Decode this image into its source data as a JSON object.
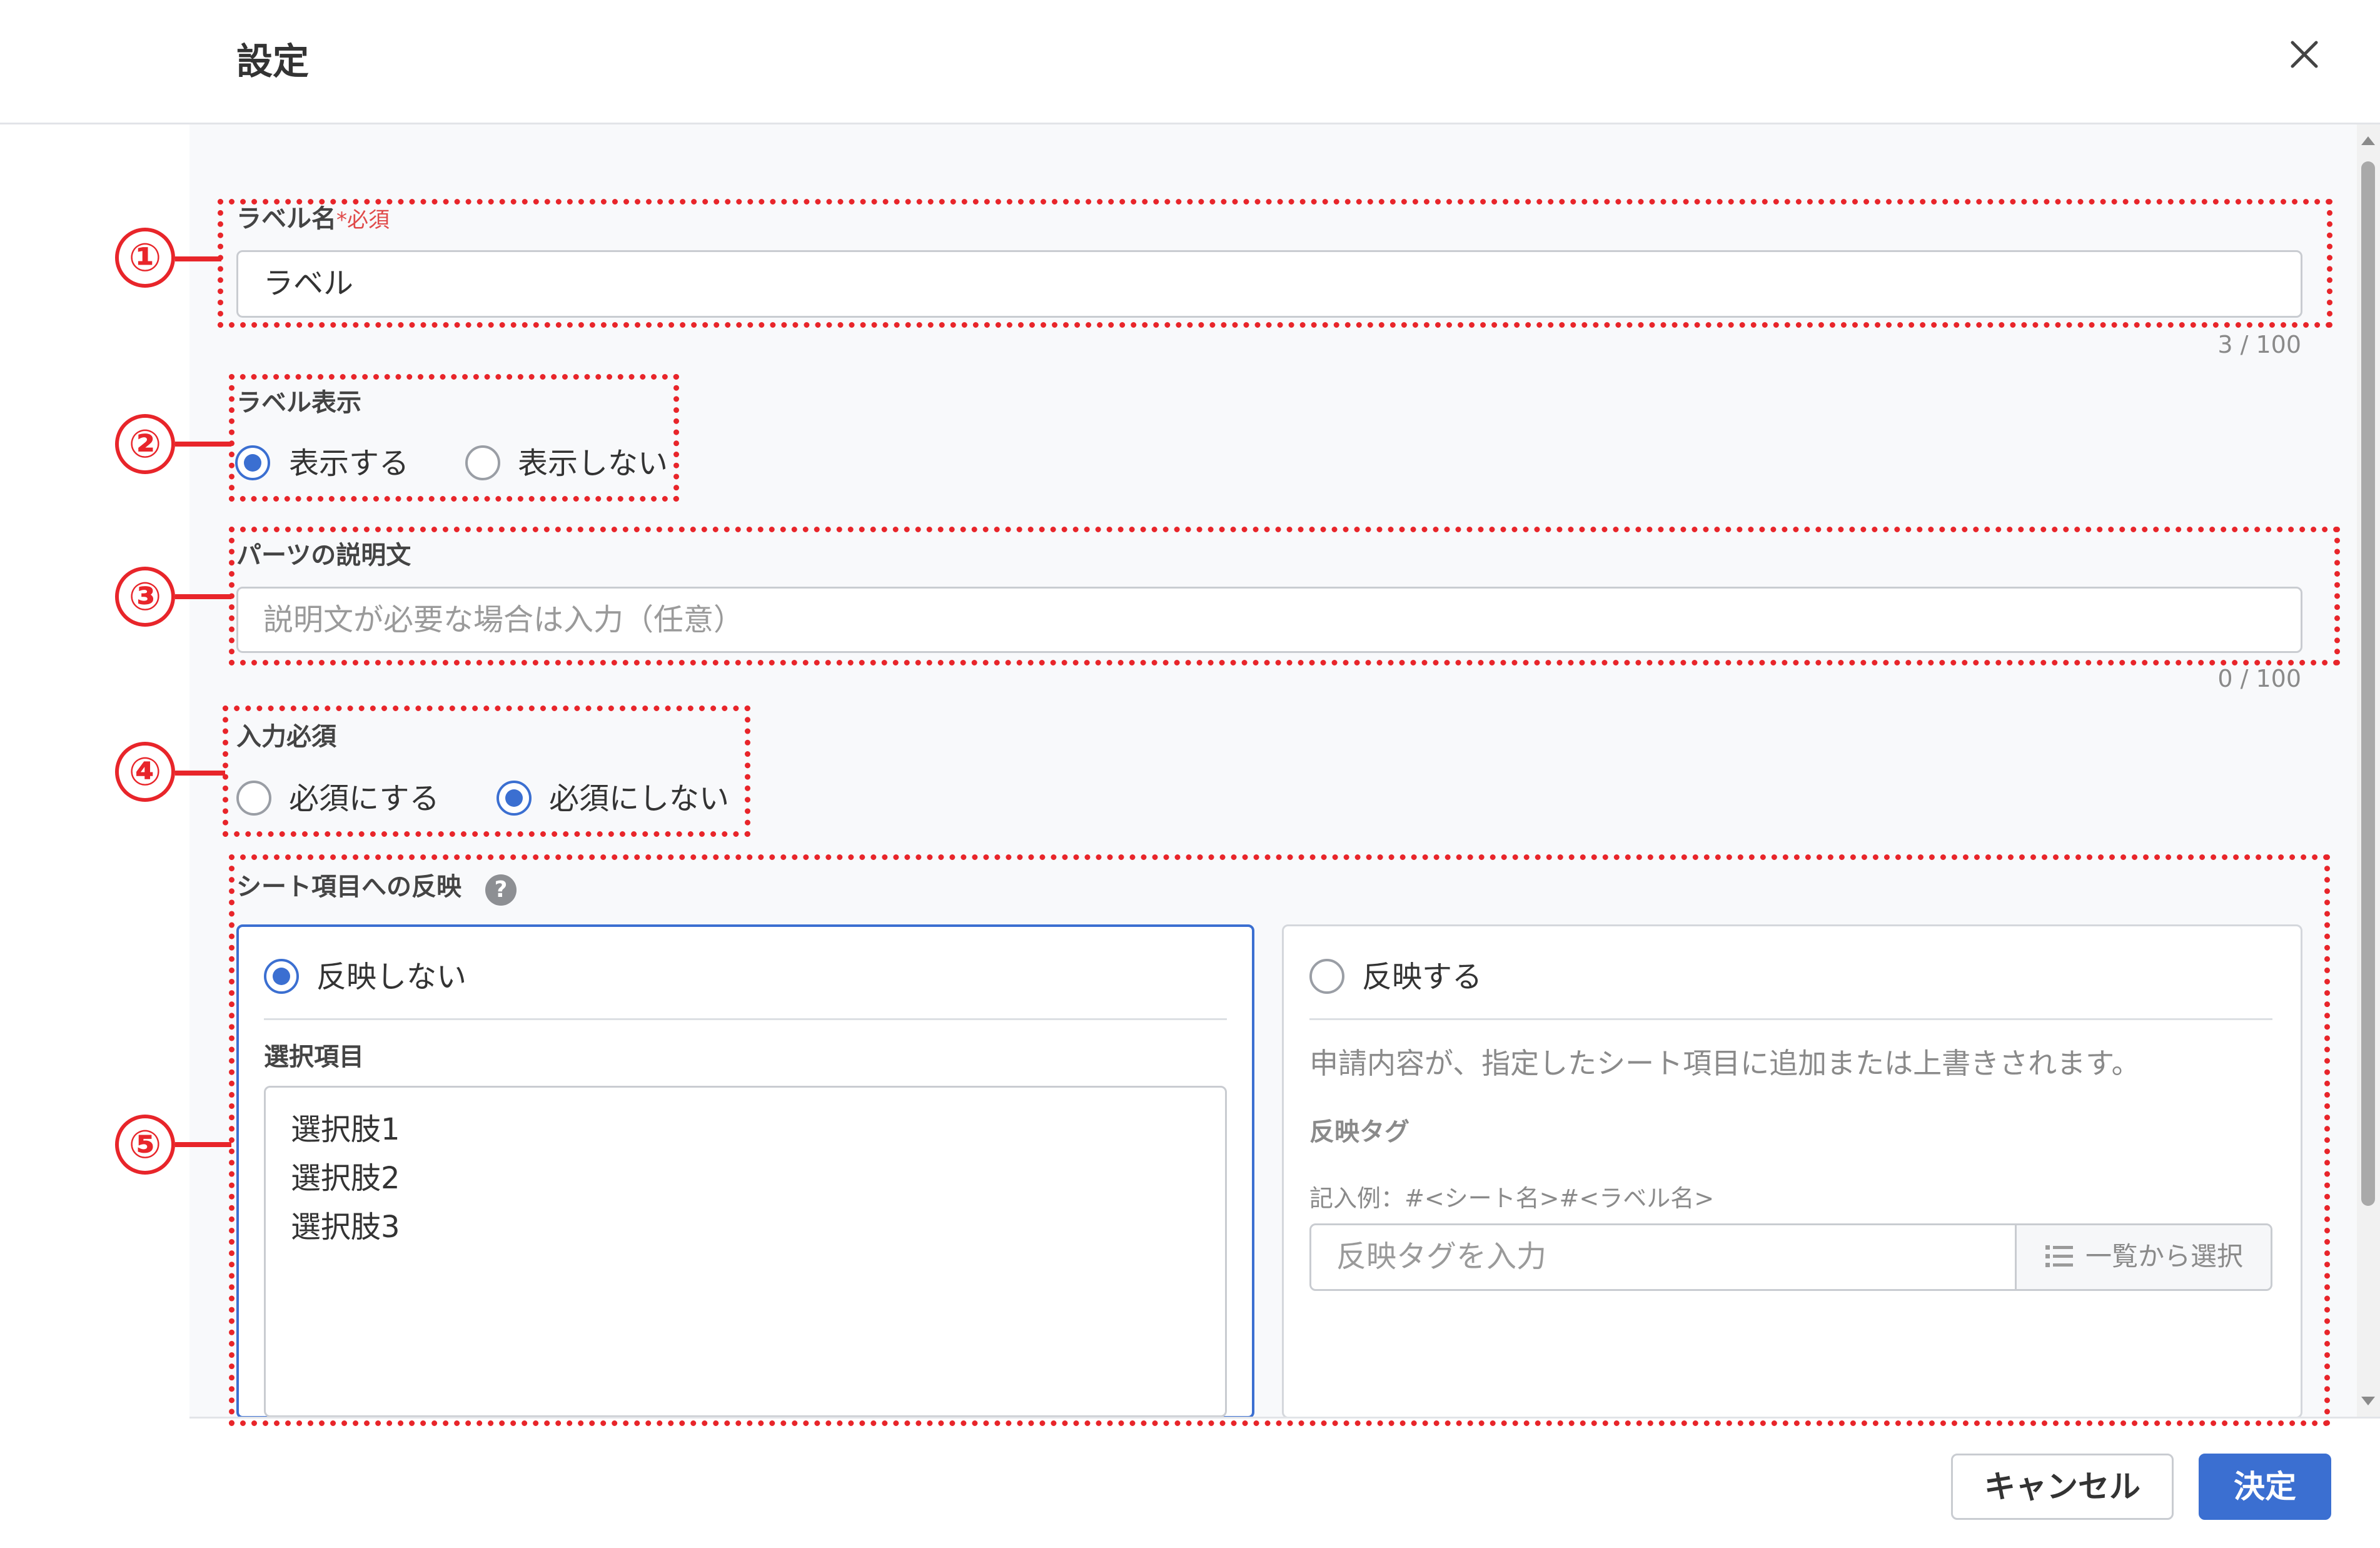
{
  "dialog": {
    "title": "設定"
  },
  "label_name": {
    "label": "ラベル名",
    "required_mark": "*必須",
    "value": "ラベル",
    "counter": "3 / 100"
  },
  "label_display": {
    "label": "ラベル表示",
    "options": [
      {
        "label": "表示する",
        "selected": true
      },
      {
        "label": "表示しない",
        "selected": false
      }
    ]
  },
  "description": {
    "label": "パーツの説明文",
    "placeholder": "説明文が必要な場合は入力（任意）",
    "counter": "0 / 100"
  },
  "required_input": {
    "label": "入力必須",
    "options": [
      {
        "label": "必須にする",
        "selected": false
      },
      {
        "label": "必須にしない",
        "selected": true
      }
    ]
  },
  "sheet_reflection": {
    "label": "シート項目への反映",
    "help_icon": "question-circle-icon",
    "no_reflect": {
      "label": "反映しない",
      "selected": true,
      "choices_label": "選択項目",
      "choices": [
        "選択肢1",
        "選択肢2",
        "選択肢3"
      ]
    },
    "reflect": {
      "label": "反映する",
      "selected": false,
      "description": "申請内容が、指定したシート項目に追加または上書きされます。",
      "tag_label": "反映タグ",
      "example": "記入例：#<シート名>#<ラベル名>",
      "tag_placeholder": "反映タグを入力",
      "list_button": "一覧から選択",
      "list_icon": "list-icon"
    }
  },
  "annotations": [
    "①",
    "②",
    "③",
    "④",
    "⑤"
  ],
  "footer": {
    "cancel": "キャンセル",
    "ok": "決定"
  },
  "colors": {
    "accent": "#3b6fd1",
    "annotation": "#e8252a",
    "required": "#e04a4a"
  }
}
